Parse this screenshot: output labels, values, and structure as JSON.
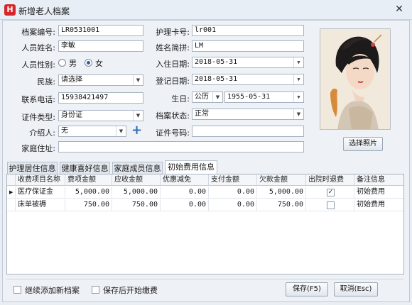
{
  "window": {
    "title": "新增老人档案",
    "app_icon_letter": "H"
  },
  "form": {
    "archive_no": {
      "label": "档案编号:",
      "value": "LR0531001"
    },
    "name": {
      "label": "人员姓名:",
      "value": "李敏"
    },
    "gender": {
      "label": "人员性别:",
      "options": [
        "男",
        "女"
      ],
      "selected": "女"
    },
    "ethnicity": {
      "label": "民族:",
      "value": "请选择"
    },
    "phone": {
      "label": "联系电话:",
      "value": "15938421497"
    },
    "id_type": {
      "label": "证件类型:",
      "value": "身份证"
    },
    "referrer": {
      "label": "介绍人:",
      "value": "无"
    },
    "home_address": {
      "label": "家庭住址:",
      "value": ""
    },
    "care_card_no": {
      "label": "护理卡号:",
      "value": "lr001"
    },
    "name_abbr": {
      "label": "姓名简拼:",
      "value": "LM"
    },
    "checkin_date": {
      "label": "入住日期:",
      "value": "2018-05-31"
    },
    "register_date": {
      "label": "登记日期:",
      "value": "2018-05-31"
    },
    "birthday": {
      "label": "生日:",
      "calendar": "公历",
      "value": "1955-05-31"
    },
    "archive_status": {
      "label": "档案状态:",
      "value": "正常"
    },
    "id_number": {
      "label": "证件号码:",
      "value": ""
    }
  },
  "photo": {
    "button_label": "选择照片"
  },
  "tabs": [
    {
      "label": "护理居住信息",
      "active": false
    },
    {
      "label": "健康喜好信息",
      "active": false
    },
    {
      "label": "家庭成员信息",
      "active": false
    },
    {
      "label": "初始费用信息",
      "active": true
    }
  ],
  "fee_table": {
    "columns": [
      "收费项目名称",
      "费项金额",
      "应收金额",
      "优惠减免",
      "支付金额",
      "欠款金额",
      "出院时退费",
      "备注信息"
    ],
    "rows": [
      {
        "item": "医疗保证金",
        "fee": "5,000.00",
        "receivable": "5,000.00",
        "discount": "0.00",
        "paid": "0.00",
        "owed": "5,000.00",
        "refund": true,
        "note": "初始费用"
      },
      {
        "item": "床单被褥",
        "fee": "750.00",
        "receivable": "750.00",
        "discount": "0.00",
        "paid": "0.00",
        "owed": "750.00",
        "refund": false,
        "note": "初始费用"
      }
    ]
  },
  "footer": {
    "continue_add_label": "继续添加新档案",
    "start_payment_label": "保存后开始缴费",
    "save_label": "保存(F5)",
    "cancel_label": "取消(Esc)"
  },
  "colors": {
    "accent": "#2b6fbf",
    "app_icon": "#d7262b",
    "background": "#eef1f6"
  }
}
